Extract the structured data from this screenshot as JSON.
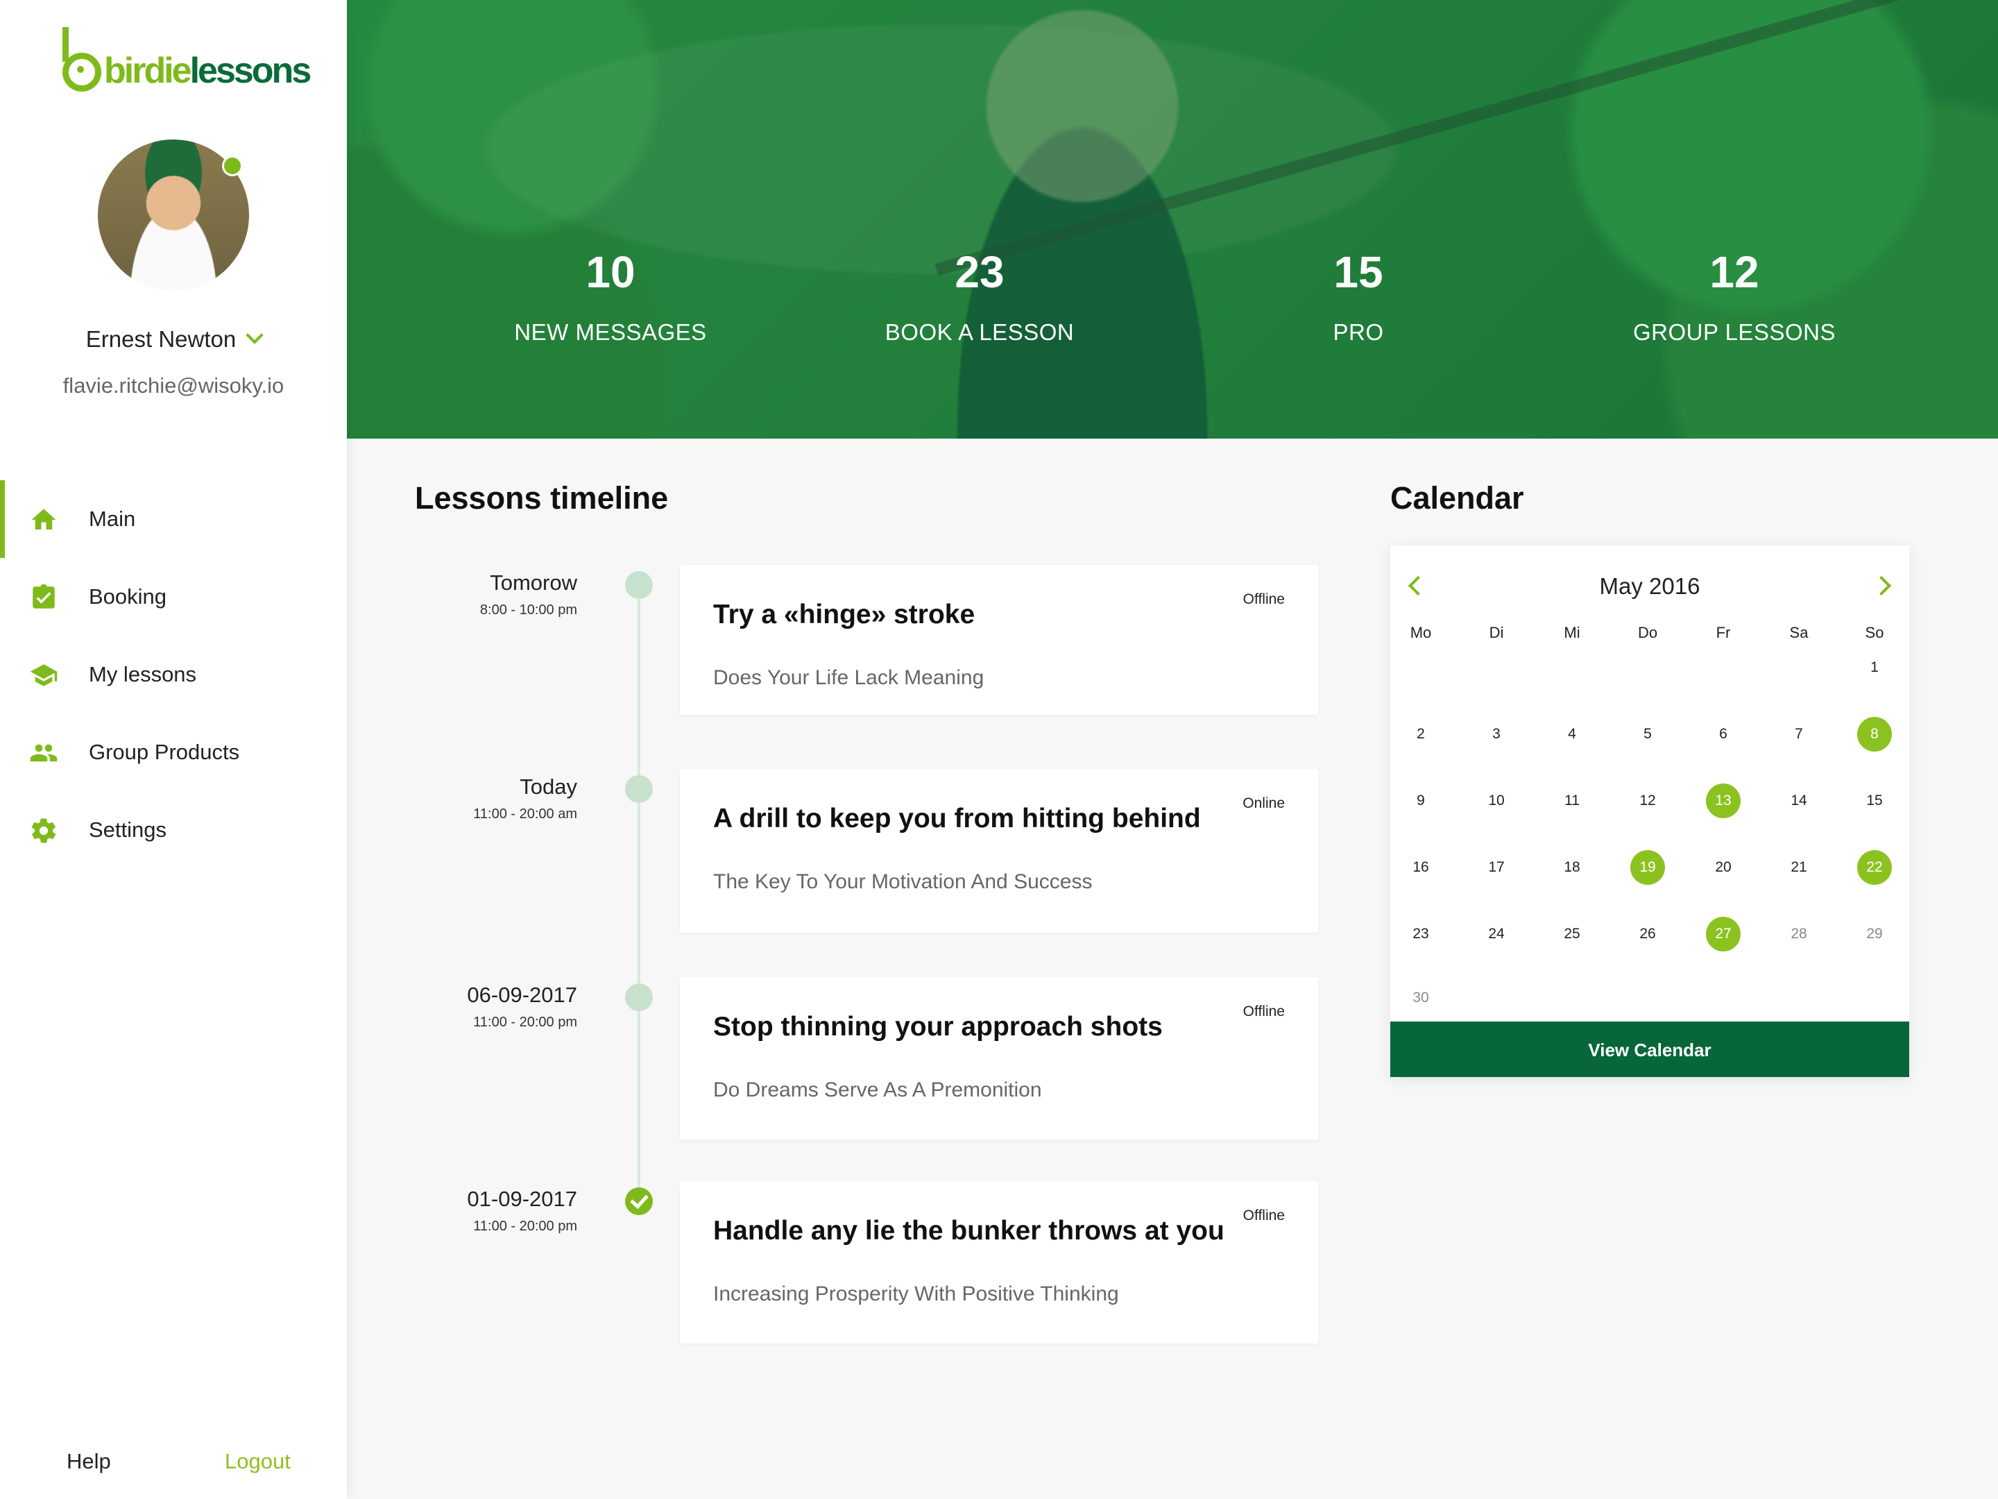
{
  "brand": {
    "part1": "birdie",
    "part2": "lessons",
    "accent": "#7fba1c",
    "dark": "#0a6b37"
  },
  "user": {
    "name": "Ernest Newton",
    "email": "flavie.ritchie@wisoky.io",
    "status": "online"
  },
  "nav": {
    "items": [
      {
        "label": "Main",
        "icon": "home-icon",
        "active": true
      },
      {
        "label": "Booking",
        "icon": "clipboard-check-icon",
        "active": false
      },
      {
        "label": "My lessons",
        "icon": "graduation-cap-icon",
        "active": false
      },
      {
        "label": "Group Products",
        "icon": "people-icon",
        "active": false
      },
      {
        "label": "Settings",
        "icon": "gear-icon",
        "active": false
      }
    ]
  },
  "footer": {
    "help": "Help",
    "logout": "Logout"
  },
  "stats": [
    {
      "value": "10",
      "label": "NEW MESSAGES"
    },
    {
      "value": "23",
      "label": "BOOK A LESSON"
    },
    {
      "value": "15",
      "label": "PRO"
    },
    {
      "value": "12",
      "label": "GROUP LESSONS"
    }
  ],
  "timeline": {
    "title": "Lessons timeline",
    "items": [
      {
        "date": "Tomorow",
        "time": "8:00 - 10:00 pm",
        "title": "Try a «hinge» stroke",
        "subtitle": "Does Your Life Lack Meaning",
        "mode": "Offline",
        "done": false
      },
      {
        "date": "Today",
        "time": "11:00 - 20:00 am",
        "title": "A drill to keep you from hitting behind",
        "subtitle": "The Key To Your Motivation And Success",
        "mode": "Online",
        "done": false
      },
      {
        "date": "06-09-2017",
        "time": "11:00 - 20:00 pm",
        "title": "Stop thinning your approach shots",
        "subtitle": "Do Dreams Serve As A Premonition",
        "mode": "Offline",
        "done": false
      },
      {
        "date": "01-09-2017",
        "time": "11:00 - 20:00 pm",
        "title": "Handle any lie the bunker throws at you",
        "subtitle": "Increasing Prosperity With Positive Thinking",
        "mode": "Offline",
        "done": true
      }
    ]
  },
  "calendar": {
    "title": "Calendar",
    "month": "May 2016",
    "weekdays": [
      "Mo",
      "Di",
      "Mi",
      "Do",
      "Fr",
      "Sa",
      "So"
    ],
    "highlighted": [
      8,
      13,
      19,
      22,
      27
    ],
    "muted": [
      28,
      29,
      30
    ],
    "button": "View Calendar"
  }
}
